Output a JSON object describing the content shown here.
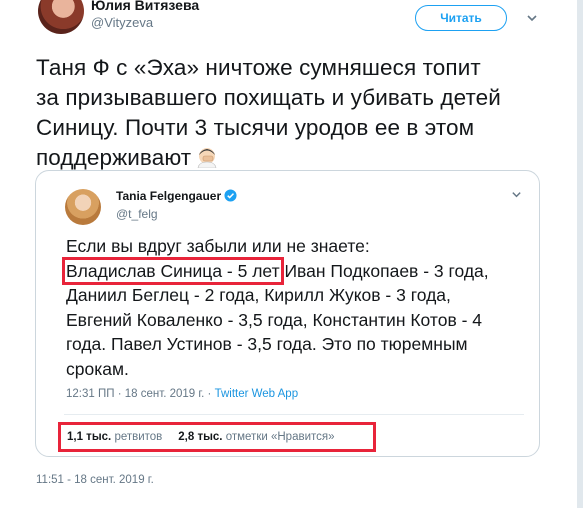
{
  "author": {
    "name": "Юлия Витязева",
    "handle": "@Vityzeva"
  },
  "follow_button": "Читать",
  "icons": {
    "menu": "chevron-down-icon",
    "verified": "verified-badge-icon",
    "emoji": "facepalm-emoji-icon"
  },
  "tweet": {
    "text_line1": "Таня Ф с «Эха» ничтоже сумняшеся топит",
    "text_line2": "за призывавшего похищать и убивать детей",
    "text_line3": "Синицу. Почти 3 тысячи уродов ее в этом",
    "text_line4": "поддерживают",
    "timestamp": "11:51 - 18 сент. 2019 г."
  },
  "quoted": {
    "name": "Tania Felgengauer",
    "handle": "@t_felg",
    "line1": "Если вы вдруг забыли или не знаете:",
    "highlight": "Владислав Синица - 5 лет",
    "line2_rest": " Иван Подкопаев - 3 года,",
    "line3": "Даниил Беглец - 2 года, Кирилл Жуков - 3 года,",
    "line4": "Евгений Коваленко - 3,5 года, Константин Котов - 4",
    "line5": "года. Павел Устинов - 3,5 года. Это по тюремным",
    "line6": "срокам.",
    "meta_time": "12:31 ПП · 18 сент. 2019 г. · ",
    "meta_app": "Twitter Web App",
    "retweets_count": "1,1 тыс.",
    "retweets_label": "ретвитов",
    "likes_count": "2,8 тыс.",
    "likes_label": "отметки «Нравится»"
  },
  "colors": {
    "accent": "#1da1f2",
    "highlight_box": "#e8243a",
    "muted": "#657786",
    "text": "#14171a"
  }
}
